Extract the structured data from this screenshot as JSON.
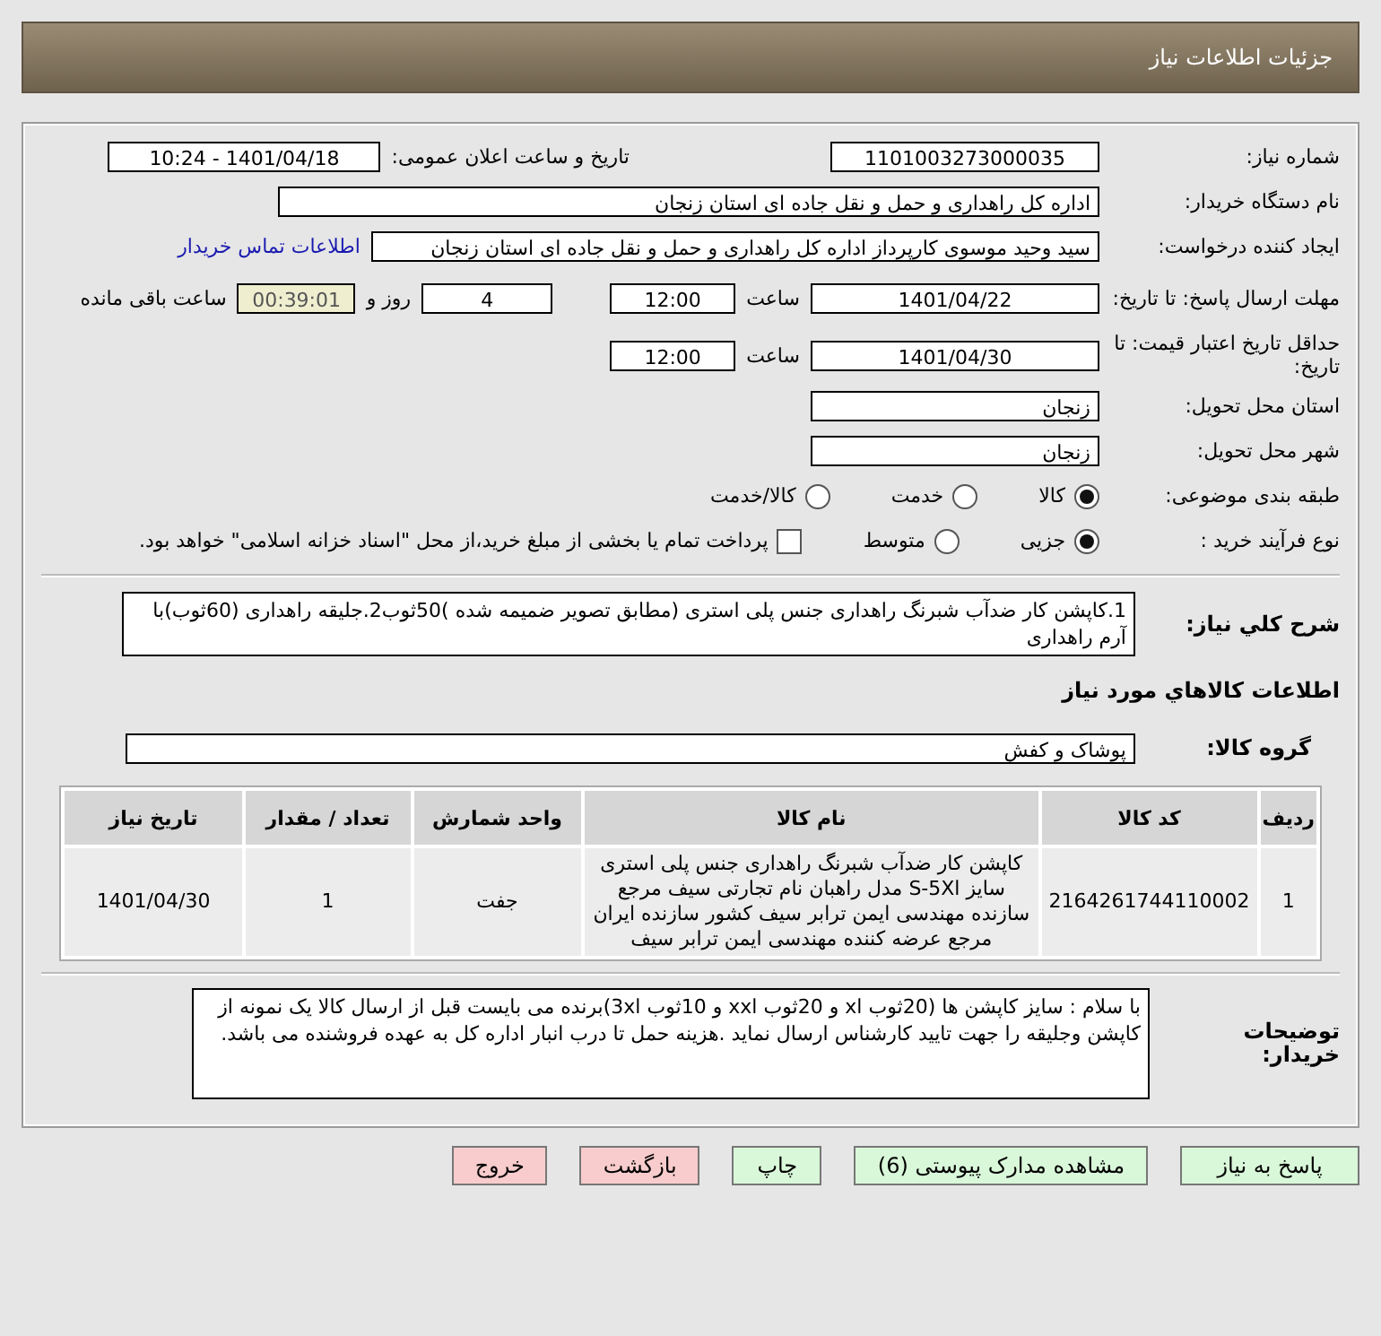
{
  "header": {
    "title": "جزئیات اطلاعات نیاز"
  },
  "need_number": {
    "label": "شماره نیاز:",
    "value": "1101003273000035"
  },
  "announce": {
    "label": "تاریخ و ساعت اعلان عمومی:",
    "value": "1401/04/18 - 10:24"
  },
  "buyer_org": {
    "label": "نام دستگاه خریدار:",
    "value": "اداره کل راهداری و حمل و نقل جاده ای استان زنجان"
  },
  "requester": {
    "label": "ایجاد کننده درخواست:",
    "value": "سید وحید موسوی کارپرداز اداره کل راهداری و حمل و نقل جاده ای استان زنجان",
    "link": "اطلاعات تماس خریدار"
  },
  "deadline": {
    "label": "مهلت ارسال پاسخ: تا تاریخ:",
    "date": "1401/04/22",
    "time_label": "ساعت",
    "time": "12:00",
    "days": "4",
    "days_label": "روز و",
    "remaining": "00:39:01",
    "remaining_label": "ساعت باقی مانده"
  },
  "validity": {
    "label": "حداقل تاریخ اعتبار قیمت: تا تاریخ:",
    "date": "1401/04/30",
    "time_label": "ساعت",
    "time": "12:00"
  },
  "province": {
    "label": "استان محل تحویل:",
    "value": "زنجان"
  },
  "city": {
    "label": "شهر محل تحویل:",
    "value": "زنجان"
  },
  "category": {
    "label": "طبقه بندی موضوعی:",
    "options": [
      {
        "label": "کالا",
        "selected": true
      },
      {
        "label": "خدمت",
        "selected": false
      },
      {
        "label": "کالا/خدمت",
        "selected": false
      }
    ]
  },
  "process": {
    "label": "نوع فرآیند خرید :",
    "options": [
      {
        "label": "جزیی",
        "selected": true
      },
      {
        "label": "متوسط",
        "selected": false
      }
    ],
    "payment": {
      "label": "پرداخت تمام یا بخشی از مبلغ خرید،از محل \"اسناد خزانه اسلامی\" خواهد بود.",
      "checked": false
    }
  },
  "description": {
    "label": "شرح کلي نیاز:",
    "value": "1.کاپشن کار ضدآب شبرنگ راهداری جنس پلی استری (مطابق تصویر ضمیمه شده )50ثوب2.جلیقه راهداری (60ثوب)با آرم راهداری"
  },
  "items_heading": "اطلاعات کالاهاي مورد نیاز",
  "goods_group": {
    "label": "گروه کالا:",
    "value": "پوشاک و کفش"
  },
  "table": {
    "columns": [
      "ردیف",
      "کد کالا",
      "نام کالا",
      "واحد شمارش",
      "تعداد / مقدار",
      "تاریخ نیاز"
    ],
    "rows": [
      [
        "1",
        "2164261744110002",
        "کاپشن کار ضدآب شبرنگ راهداری جنس پلی استری سایز S-5Xl مدل راهبان نام تجارتی سیف مرجع سازنده مهندسی ایمن ترابر سیف کشور سازنده ایران مرجع عرضه کننده مهندسی ایمن ترابر سیف",
        "جفت",
        "1",
        "1401/04/30"
      ]
    ]
  },
  "buyer_notes": {
    "label": "توضیحات خریدار:",
    "value": "با سلام : سایز کاپشن ها (20ثوب xl و 20ثوب xxl و 10ثوب 3xl)برنده می بایست قبل از ارسال کالا یک نمونه از کاپشن وجلیقه را جهت تایید کارشناس ارسال نماید .هزینه حمل تا درب انبار اداره کل به عهده فروشنده می باشد."
  },
  "buttons": [
    {
      "label": "پاسخ به نیاز",
      "kind": "primary"
    },
    {
      "label": "مشاهده مدارک پیوستی (6)",
      "kind": "primary"
    },
    {
      "label": "چاپ",
      "kind": "primary"
    },
    {
      "label": "بازگشت",
      "kind": "danger"
    },
    {
      "label": "خروج",
      "kind": "danger"
    }
  ]
}
